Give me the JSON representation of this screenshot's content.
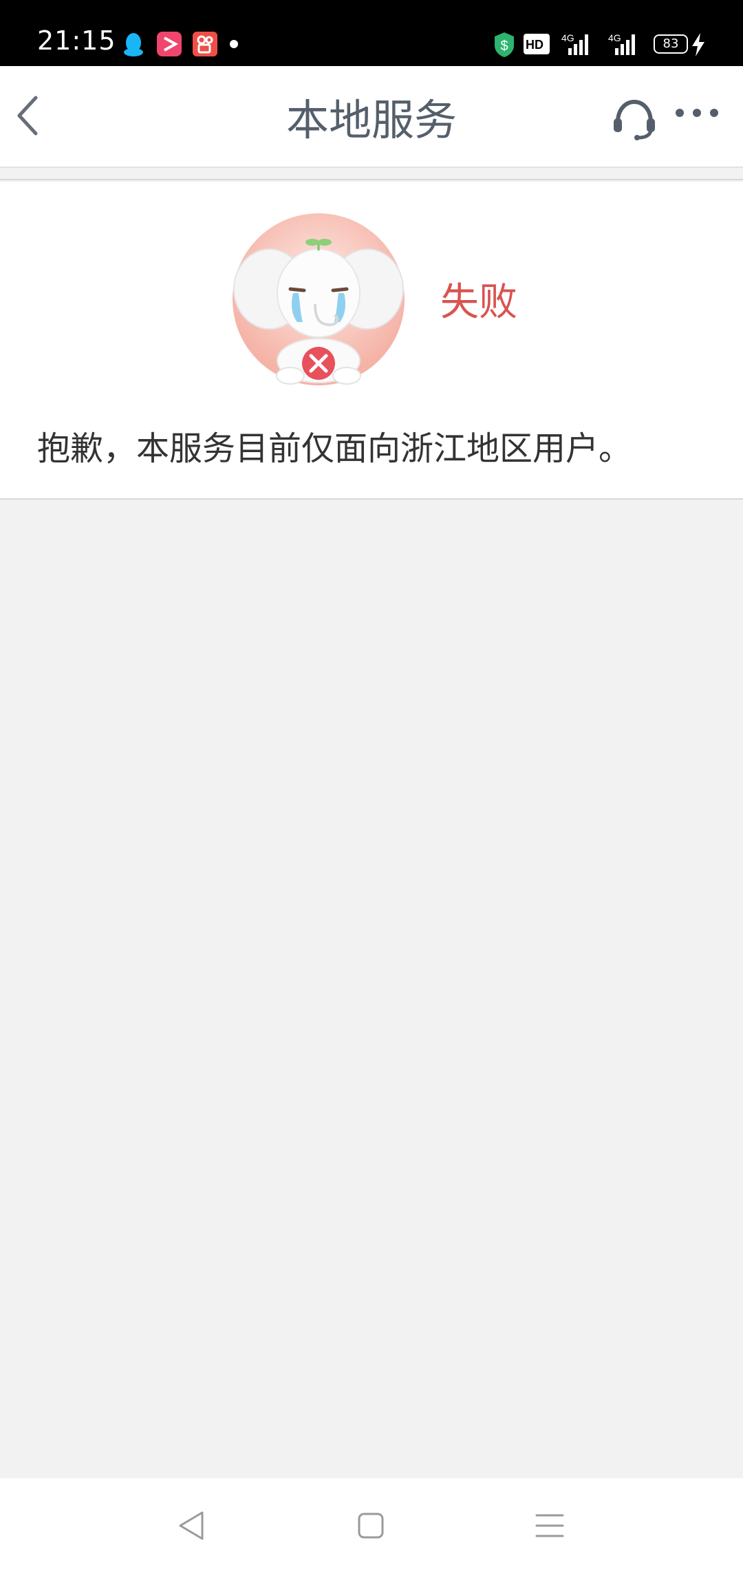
{
  "status_bar": {
    "time": "21:15",
    "notification_icons": [
      "qq-penguin-icon",
      "video-play-app-icon",
      "kuaishou-app-icon",
      "more-dot-icon"
    ],
    "system_icons": [
      "security-shield-icon",
      "hd-voice-icon",
      "signal-4g-icon",
      "signal-4g-icon",
      "battery-icon",
      "charging-bolt-icon"
    ],
    "battery_level": "83"
  },
  "nav_bar": {
    "title": "本地服务",
    "icons": [
      "back-arrow-icon",
      "headset-service-icon",
      "more-dots-icon"
    ]
  },
  "result": {
    "status_label": "失败",
    "status_color": "#d9534f",
    "message": "抱歉，本服务目前仅面向浙江地区用户。",
    "illustration": "crying-elephant-mascot"
  },
  "system_nav": {
    "icons": [
      "back-triangle-icon",
      "home-square-icon",
      "menu-lines-icon"
    ]
  }
}
